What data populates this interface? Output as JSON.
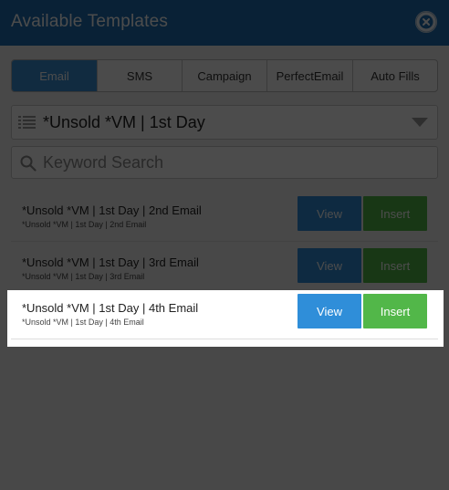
{
  "header": {
    "title": "Available Templates"
  },
  "tabs": [
    {
      "label": "Email",
      "active": true
    },
    {
      "label": "SMS",
      "active": false
    },
    {
      "label": "Campaign",
      "active": false
    },
    {
      "label": "PerfectEmail",
      "active": false
    },
    {
      "label": "Auto Fills",
      "active": false
    }
  ],
  "category_select": {
    "value": "*Unsold *VM | 1st Day"
  },
  "search": {
    "placeholder": "Keyword Search",
    "value": ""
  },
  "templates": [
    {
      "title": "*Unsold *VM | 1st Day | 2nd Email",
      "subtitle": "*Unsold *VM | 1st Day | 2nd Email",
      "view_label": "View",
      "insert_label": "Insert"
    },
    {
      "title": "*Unsold *VM | 1st Day | 3rd Email",
      "subtitle": "*Unsold *VM | 1st Day | 3rd Email",
      "view_label": "View",
      "insert_label": "Insert"
    },
    {
      "title": "*Unsold *VM | 1st Day | 4th Email",
      "subtitle": "*Unsold *VM | 1st Day | 4th Email",
      "view_label": "View",
      "insert_label": "Insert"
    }
  ],
  "colors": {
    "header": "#1e6fb5",
    "tab_active": "#3a8fd6",
    "view_button": "#2f8ed9",
    "insert_button": "#52b749"
  }
}
